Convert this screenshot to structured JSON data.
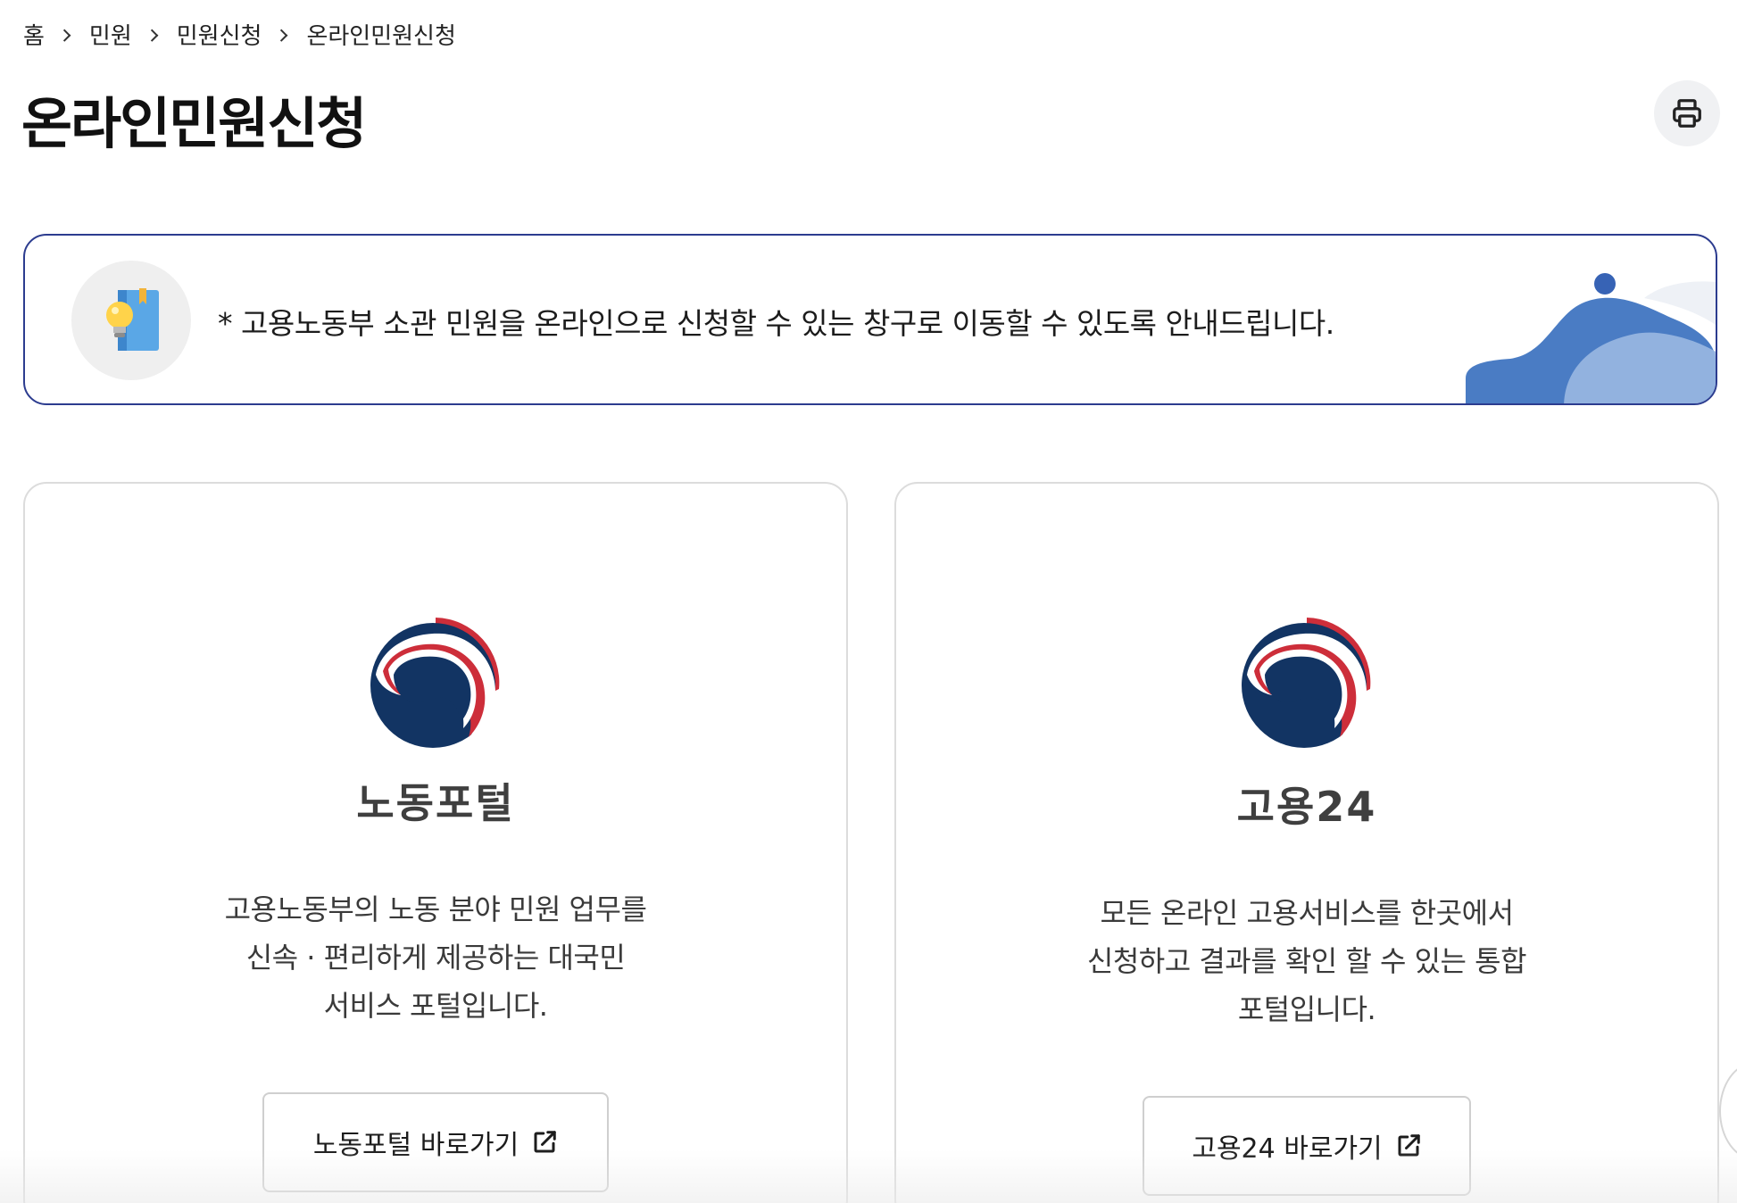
{
  "breadcrumb": {
    "items": [
      "홈",
      "민원",
      "민원신청",
      "온라인민원신청"
    ]
  },
  "page": {
    "title": "온라인민원신청"
  },
  "toolbar": {
    "print_icon": "printer-icon"
  },
  "notice": {
    "icon": "lightbulb-book-icon",
    "text": "* 고용노동부 소관 민원을 온라인으로 신청할 수 있는 창구로 이동할 수 있도록 안내드립니다."
  },
  "cards": [
    {
      "logo": "taegeuk-government-logo",
      "title": "노동포털",
      "desc": [
        "고용노동부의 노동 분야 민원 업무를",
        "신속 · 편리하게 제공하는 대국민",
        "서비스 포털입니다."
      ],
      "button_label": "노동포털 바로가기",
      "button_icon": "external-link-icon"
    },
    {
      "logo": "taegeuk-government-logo",
      "title": "고용24",
      "desc": [
        "모든 온라인 고용서비스를 한곳에서",
        "신청하고 결과를 확인 할 수 있는 통합",
        "포털입니다."
      ],
      "button_label": "고용24 바로가기",
      "button_icon": "external-link-icon"
    }
  ],
  "colors": {
    "notice_border": "#2c3c8f",
    "logo_blue": "#123463",
    "logo_red": "#cd2e3a",
    "deco_blue": "#4a7cc4"
  }
}
